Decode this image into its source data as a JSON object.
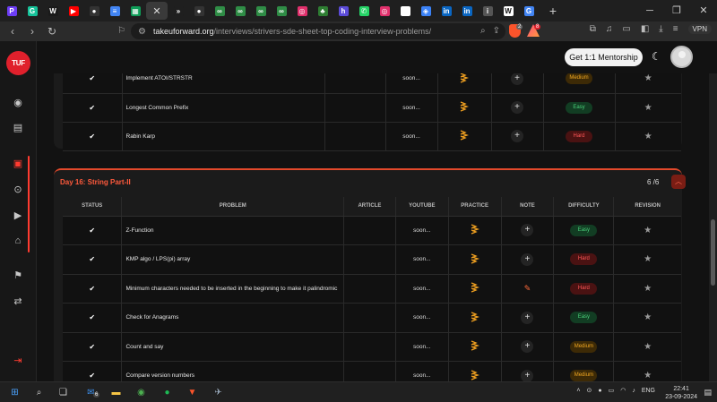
{
  "browser": {
    "tabs": [
      {
        "icon": "purple-tab-icon",
        "color": "#6d3df5",
        "glyph": "P"
      },
      {
        "icon": "grammarly-tab-icon",
        "color": "#15c39a",
        "glyph": "G"
      },
      {
        "icon": "w-tab-icon",
        "color": "#1a1a1a",
        "glyph": "W"
      },
      {
        "icon": "youtube-tab-icon",
        "color": "#ff0000",
        "glyph": "▶"
      },
      {
        "icon": "github-tab-icon",
        "color": "#333333",
        "glyph": "●"
      },
      {
        "icon": "docs-tab-icon",
        "color": "#4285f4",
        "glyph": "≡"
      },
      {
        "icon": "sheets-tab-icon",
        "color": "#0f9d58",
        "glyph": "▦"
      },
      {
        "icon": "tuf-tab-icon",
        "color": "#333333",
        "glyph": "✕",
        "active": true
      },
      {
        "icon": "tuf-arrow-tab-icon",
        "color": "#1f1f1f",
        "glyph": "»"
      },
      {
        "icon": "github-tab-icon",
        "color": "#333333",
        "glyph": "●"
      },
      {
        "icon": "gfg-tab-icon",
        "color": "#2f8d46",
        "glyph": "∞"
      },
      {
        "icon": "gfg-tab-icon",
        "color": "#2f8d46",
        "glyph": "∞"
      },
      {
        "icon": "gfg-tab-icon",
        "color": "#2f8d46",
        "glyph": "∞"
      },
      {
        "icon": "gfg-tab-icon",
        "color": "#2f8d46",
        "glyph": "∞"
      },
      {
        "icon": "instagram-tab-icon",
        "color": "#e1306c",
        "glyph": "◎"
      },
      {
        "icon": "palm-tab-icon",
        "color": "#2e7d32",
        "glyph": "♣"
      },
      {
        "icon": "hd-tab-icon",
        "color": "#5b4bd8",
        "glyph": "h"
      },
      {
        "icon": "whatsapp-tab-icon",
        "color": "#25d366",
        "glyph": "✆"
      },
      {
        "icon": "instagram-tab-icon",
        "color": "#e1306c",
        "glyph": "◎"
      },
      {
        "icon": "white-tab-icon",
        "color": "#ffffff",
        "glyph": ""
      },
      {
        "icon": "vpn-tab-icon",
        "color": "#3b82f6",
        "glyph": "◈"
      },
      {
        "icon": "linkedin-tab-icon",
        "color": "#0a66c2",
        "glyph": "in"
      },
      {
        "icon": "linkedin-tab-icon",
        "color": "#0a66c2",
        "glyph": "in"
      },
      {
        "icon": "info-tab-icon",
        "color": "#555555",
        "glyph": "i"
      },
      {
        "icon": "wiki-tab-icon",
        "color": "#ffffff",
        "glyph": "W"
      },
      {
        "icon": "chrome-tab-icon",
        "color": "#4285f4",
        "glyph": "G"
      }
    ],
    "url_domain": "takeuforward.org",
    "url_path": "/interviews/strivers-sde-sheet-top-coding-interview-problems/",
    "vpn_label": "VPN",
    "shield_count": "2",
    "rewards_count": "8"
  },
  "site": {
    "logo_text": "TUF",
    "mentorship_label": "Get 1:1 Mentorship"
  },
  "prev_section": {
    "rows": [
      {
        "problem": "Implement ATOI/STRSTR",
        "youtube": "soon...",
        "difficulty": "Medium"
      },
      {
        "problem": "Longest Common Prefix",
        "youtube": "soon...",
        "difficulty": "Easy"
      },
      {
        "problem": "Rabin Karp",
        "youtube": "soon...",
        "difficulty": "Hard"
      }
    ]
  },
  "section": {
    "title": "Day 16: String Part-II",
    "count": "6 /6",
    "columns": [
      "STATUS",
      "PROBLEM",
      "ARTICLE",
      "YOUTUBE",
      "PRACTICE",
      "NOTE",
      "DIFFICULTY",
      "REVISION"
    ],
    "rows": [
      {
        "problem": "Z-Function",
        "youtube": "soon...",
        "difficulty": "Easy",
        "note": "add"
      },
      {
        "problem": "KMP algo / LPS(pi) array",
        "youtube": "soon...",
        "difficulty": "Hard",
        "note": "add"
      },
      {
        "problem": "Minimum characters needed to be inserted in the beginning to make it palindromic",
        "youtube": "soon...",
        "difficulty": "Hard",
        "note": "edit"
      },
      {
        "problem": "Check for Anagrams",
        "youtube": "soon...",
        "difficulty": "Easy",
        "note": "add"
      },
      {
        "problem": "Count and say",
        "youtube": "soon...",
        "difficulty": "Medium",
        "note": "add"
      },
      {
        "problem": "Compare version numbers",
        "youtube": "soon...",
        "difficulty": "Medium",
        "note": "add"
      }
    ]
  },
  "taskbar": {
    "language": "ENG",
    "time": "22:41",
    "date": "23-09-2024",
    "mail_badge": "6"
  }
}
